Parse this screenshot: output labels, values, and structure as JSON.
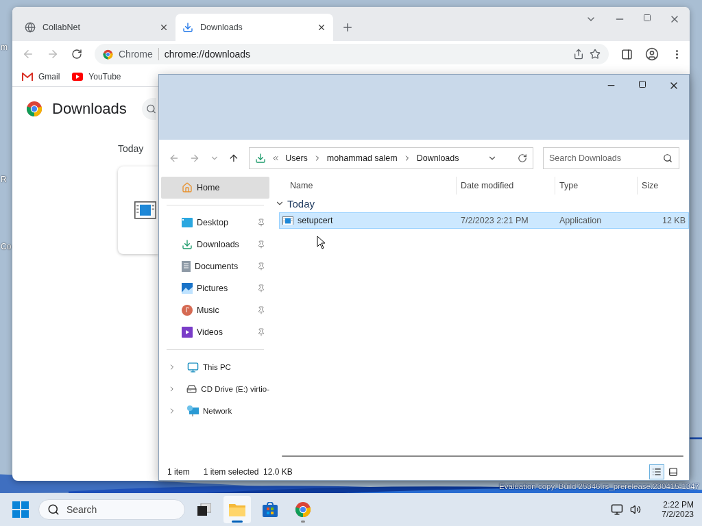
{
  "desktop": {
    "icon_labels": [
      "m",
      "R",
      "Co"
    ],
    "watermark": "Evaluation copy. Build 25346.rs_prerelease.230415-1347"
  },
  "chrome": {
    "tabs": [
      {
        "title": "CollabNet",
        "kind": "globe",
        "selected": false
      },
      {
        "title": "Downloads",
        "kind": "download",
        "selected": true
      }
    ],
    "omnibox": {
      "chip": "Chrome",
      "url": "chrome://downloads"
    },
    "bookmarks": [
      {
        "label": "Gmail",
        "kind": "gmail"
      },
      {
        "label": "YouTube",
        "kind": "youtube"
      }
    ],
    "page": {
      "title": "Downloads",
      "section": "Today"
    }
  },
  "explorer": {
    "breadcrumb": [
      "Users",
      "mohammad salem",
      "Downloads"
    ],
    "search": {
      "placeholder": "Search Downloads"
    },
    "home": {
      "label": "Home",
      "selected": true
    },
    "quick_access": [
      {
        "label": "Desktop",
        "kind": "desktop",
        "pinned": true
      },
      {
        "label": "Downloads",
        "kind": "downloads",
        "pinned": true
      },
      {
        "label": "Documents",
        "kind": "documents",
        "pinned": true
      },
      {
        "label": "Pictures",
        "kind": "pictures",
        "pinned": true
      },
      {
        "label": "Music",
        "kind": "music",
        "pinned": true
      },
      {
        "label": "Videos",
        "kind": "videos",
        "pinned": true
      }
    ],
    "locations": [
      {
        "label": "This PC",
        "kind": "pc",
        "expanded": false
      },
      {
        "label": "CD Drive (E:) virtio-",
        "kind": "drive",
        "expanded": false
      },
      {
        "label": "Network",
        "kind": "network",
        "expanded": false
      }
    ],
    "columns": [
      "Name",
      "Date modified",
      "Type",
      "Size"
    ],
    "group": {
      "label": "Today",
      "expanded": true
    },
    "files": [
      {
        "name": "setupcert",
        "date": "7/2/2023 2:21 PM",
        "type": "Application",
        "size": "12 KB",
        "selected": true
      }
    ],
    "status": {
      "count": "1 item",
      "selection": "1 item selected",
      "size": "12.0 KB"
    },
    "view_buttons": [
      {
        "kind": "details",
        "selected": true
      },
      {
        "kind": "preview",
        "selected": false
      }
    ]
  },
  "taskbar": {
    "search": {
      "placeholder": "Search"
    },
    "apps": [
      {
        "kind": "taskview",
        "active": false,
        "running": false
      },
      {
        "kind": "explorer",
        "active": true,
        "running": true
      },
      {
        "kind": "store",
        "active": false,
        "running": false
      },
      {
        "kind": "chrome",
        "active": false,
        "running": true
      }
    ],
    "time": "2:22 PM",
    "date": "7/2/2023"
  }
}
